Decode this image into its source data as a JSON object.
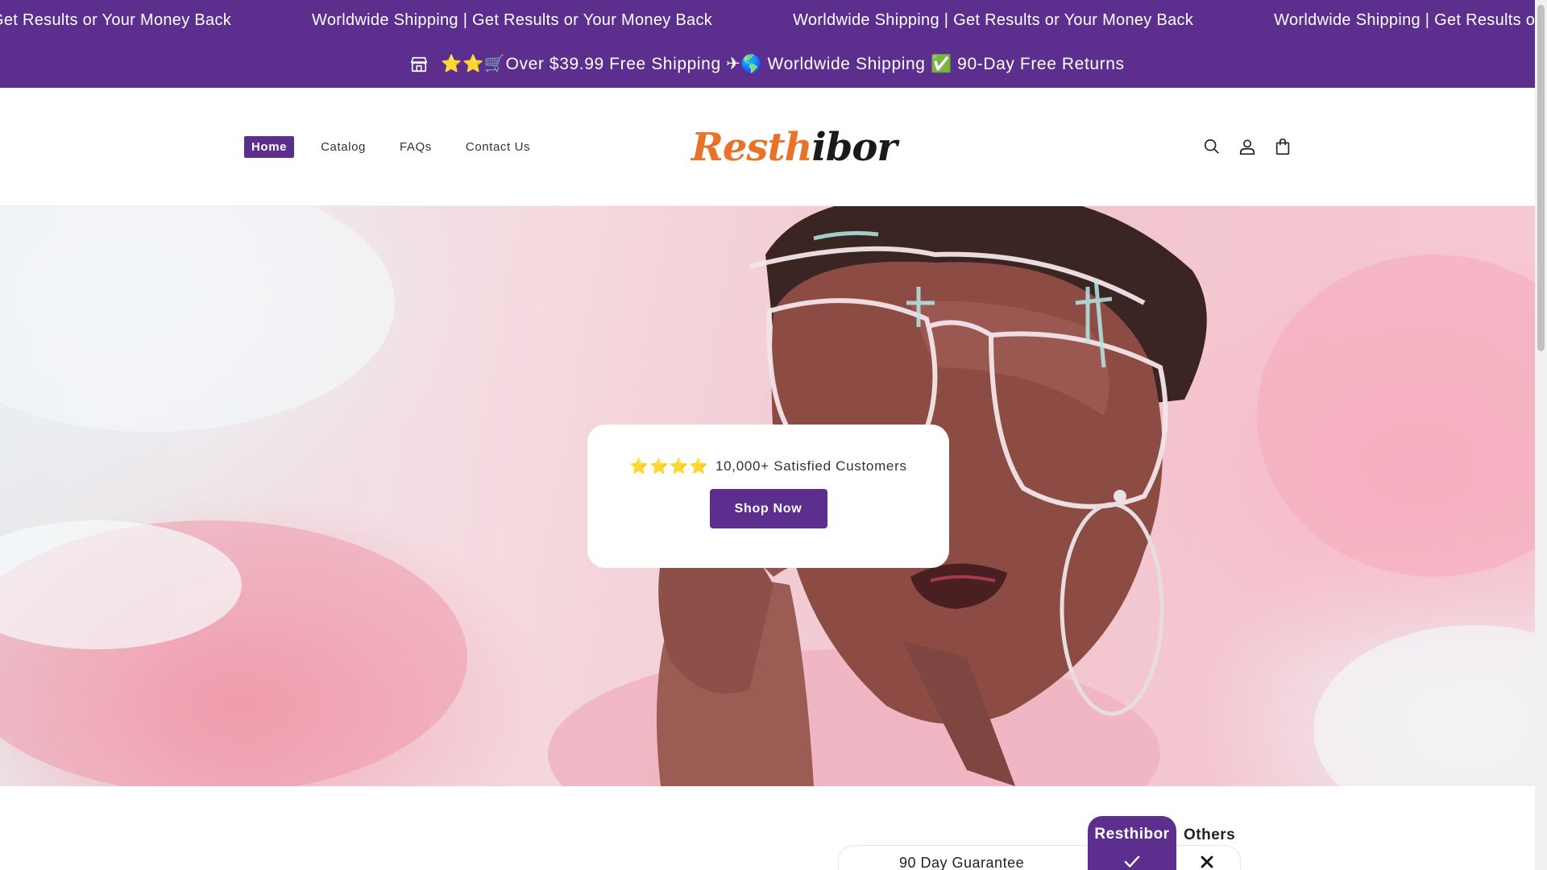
{
  "marquee": {
    "items": [
      "Worldwide Shipping | Get Results or Your Money Back",
      "Worldwide Shipping | Get Results or Your Money Back",
      "Worldwide Shipping | Get Results or Your Money Back",
      "Worldwide Shipping | Get Results or Your Money Back"
    ]
  },
  "announcement": {
    "icon": "store-icon",
    "stars": "⭐⭐",
    "text": "🛒Over $39.99 Free Shipping ✈🌎 Worldwide Shipping ✅ 90-Day Free Returns"
  },
  "nav": {
    "items": [
      {
        "label": "Home",
        "active": true
      },
      {
        "label": "Catalog",
        "active": false
      },
      {
        "label": "FAQs",
        "active": false
      },
      {
        "label": "Contact Us",
        "active": false
      }
    ]
  },
  "logo": {
    "part1": "Resth",
    "part2": "ibor"
  },
  "header_icons": [
    "search-icon",
    "account-icon",
    "cart-icon"
  ],
  "hero": {
    "stars": "⭐⭐⭐⭐",
    "rating_text": "10,000+ Satisfied Customers",
    "cta_label": "Shop Now"
  },
  "comparison": {
    "brand_label": "Resthibor",
    "others_label": "Others",
    "rows": [
      {
        "label": "90 Day Guarantee",
        "brand": "check-icon",
        "others": "cross-icon"
      }
    ]
  },
  "colors": {
    "brand_purple": "#5c2f8e",
    "logo_orange": "#e8722a",
    "star_gold": "#f5b50a"
  }
}
